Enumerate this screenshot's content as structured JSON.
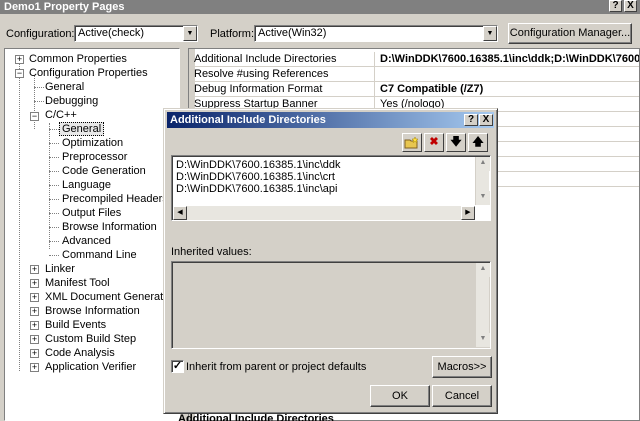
{
  "window": {
    "title": "Demo1 Property Pages",
    "help_btn": "?",
    "close_btn": "X"
  },
  "toolbar": {
    "configuration_label": "Configuration:",
    "configuration_value": "Active(check)",
    "platform_label": "Platform:",
    "platform_value": "Active(Win32)",
    "config_manager_label": "Configuration Manager..."
  },
  "tree": {
    "common_properties": "Common Properties",
    "configuration_properties": "Configuration Properties",
    "general": "General",
    "debugging": "Debugging",
    "c_cpp": "C/C++",
    "cpp_general": "General",
    "optimization": "Optimization",
    "preprocessor": "Preprocessor",
    "code_generation": "Code Generation",
    "language": "Language",
    "precompiled_headers": "Precompiled Headers",
    "output_files": "Output Files",
    "browse_information": "Browse Information",
    "advanced": "Advanced",
    "command_line": "Command Line",
    "linker": "Linker",
    "manifest_tool": "Manifest Tool",
    "xml_document_generator": "XML Document Generator",
    "browse_information_2": "Browse Information",
    "build_events": "Build Events",
    "custom_build_step": "Custom Build Step",
    "code_analysis": "Code Analysis",
    "application_verifier": "Application Verifier"
  },
  "grid": {
    "rows": [
      {
        "name": "Additional Include Directories",
        "value": "D:\\WinDDK\\7600.16385.1\\inc\\ddk;D:\\WinDDK\\7600."
      },
      {
        "name": "Resolve #using References",
        "value": ""
      },
      {
        "name": "Debug Information Format",
        "value": "C7 Compatible (/Z7)"
      },
      {
        "name": "Suppress Startup Banner",
        "value": "Yes (/nologo)"
      }
    ],
    "description_title": "Additional Include Directories"
  },
  "dialog": {
    "title": "Additional Include Directories",
    "help_btn": "?",
    "close_btn": "X",
    "new_line_icon": "folder-new-icon",
    "delete_icon": "delete-icon",
    "move_down_icon": "arrow-down-icon",
    "move_up_icon": "arrow-up-icon",
    "directories": [
      "D:\\WinDDK\\7600.16385.1\\inc\\ddk",
      "D:\\WinDDK\\7600.16385.1\\inc\\crt",
      "D:\\WinDDK\\7600.16385.1\\inc\\api"
    ],
    "inherited_label": "Inherited values:",
    "inherit_checkbox_label": "Inherit from parent or project defaults",
    "inherit_checked": true,
    "macros_label": "Macros>>",
    "ok_label": "OK",
    "cancel_label": "Cancel"
  }
}
